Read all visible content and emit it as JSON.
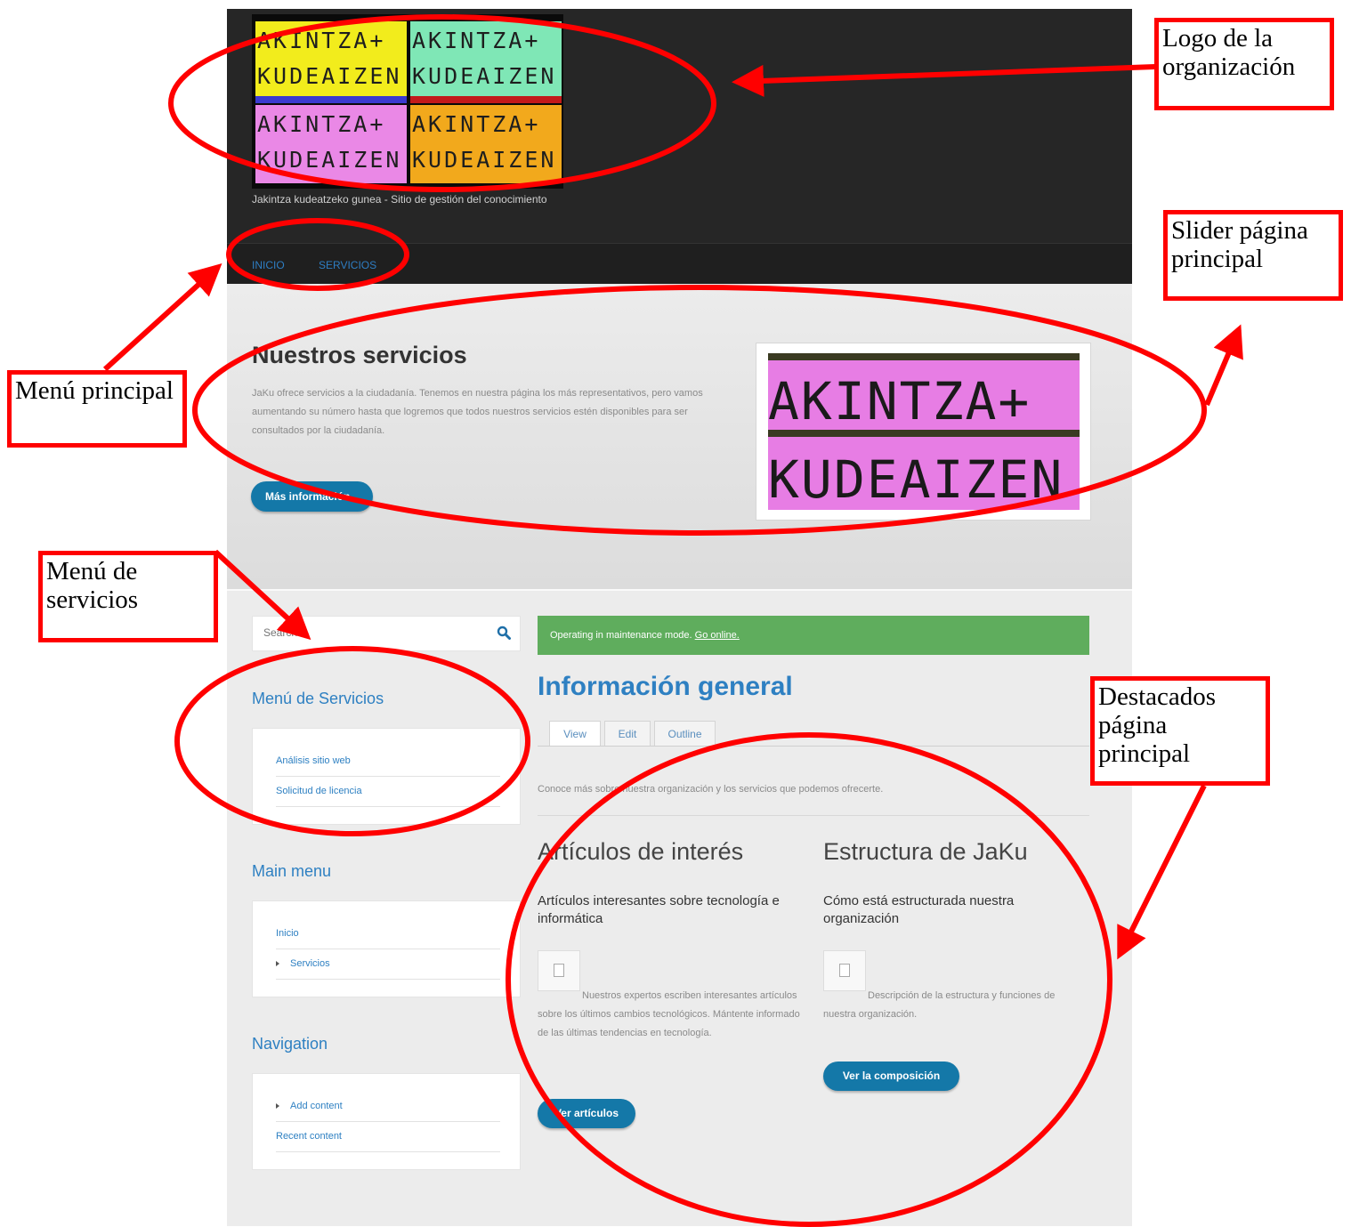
{
  "site": {
    "logo_quadrant_text": "AKINTZA+\nKUDEAIZEN",
    "slogan": "Jakintza kudeatzeko gunea - Sitio de gestión del conocimiento",
    "nav": [
      "INICIO",
      "SERVICIOS"
    ]
  },
  "hero": {
    "title": "Nuestros servicios",
    "text": "JaKu ofrece servicios a la ciudadanía. Tenemos en nuestra página los más representativos, pero vamos aumentando su número hasta que logremos que todos nuestros servicios estén disponibles para ser consultados por la ciudadanía.",
    "button": "Más información",
    "image_text": "AKINTZA+\nKUDEAIZEN"
  },
  "sidebar": {
    "search_placeholder": "Search",
    "services_menu": {
      "title": "Menú de Servicios",
      "items": [
        "Análisis sitio web",
        "Solicitud de licencia"
      ]
    },
    "main_menu": {
      "title": "Main menu",
      "items": [
        "Inicio",
        "Servicios"
      ]
    },
    "navigation": {
      "title": "Navigation",
      "items": [
        "Add content",
        "Recent content"
      ]
    }
  },
  "main": {
    "alert": {
      "text": "Operating in maintenance mode.",
      "link": "Go online."
    },
    "page_title": "Información general",
    "tabs": [
      "View",
      "Edit",
      "Outline"
    ],
    "intro": "Conoce más sobre nuestra organización y los servicios que podemos ofrecerte.",
    "featured": [
      {
        "title": "Artículos de interés",
        "subtitle": "Artículos interesantes sobre tecnología e informática",
        "text": "Nuestros expertos escriben interesantes artículos sobre los últimos cambios tecnológicos. Mántente informado de las últimas tendencias en tecnología.",
        "button": "Ver artículos"
      },
      {
        "title": "Estructura de JaKu",
        "subtitle": "Cómo está estructurada nuestra organización",
        "text": "Descripción de la estructura y funciones de nuestra organización.",
        "button": "Ver la composición"
      }
    ]
  },
  "annotations": {
    "logo": "Logo de la organización",
    "slider": "Slider página principal",
    "main_menu": "Menú principal",
    "services_menu": "Menú de servicios",
    "featured": "Destacados página principal"
  },
  "colors": {
    "annotation": "#ff0000",
    "link": "#2e80c2",
    "button": "#1478a8",
    "alert": "#5fad5d"
  }
}
